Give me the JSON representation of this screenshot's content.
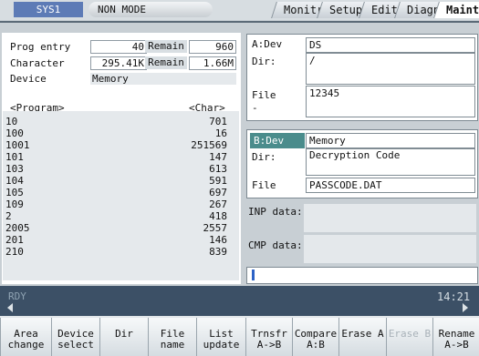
{
  "header": {
    "sys": "SYS1",
    "mode": "NON MODE",
    "tabs": [
      {
        "label": "Monitr",
        "active": false
      },
      {
        "label": "Setup",
        "active": false
      },
      {
        "label": "Edit",
        "active": false
      },
      {
        "label": "Diagn",
        "active": false
      },
      {
        "label": "Mainte",
        "active": true
      }
    ]
  },
  "stats": {
    "prog_entry_label": "Prog entry",
    "prog_entry_value": "40",
    "remain_label": "Remain",
    "prog_remain_value": "960",
    "character_label": "Character",
    "character_value": "295.41K",
    "char_remain_value": "1.66M",
    "device_label": "Device",
    "device_value": "Memory"
  },
  "program_list": {
    "col_program": "<Program>",
    "col_char": "<Char>",
    "rows": [
      {
        "name": "10",
        "chars": "701"
      },
      {
        "name": "100",
        "chars": "16"
      },
      {
        "name": "1001",
        "chars": "251569"
      },
      {
        "name": "101",
        "chars": "147"
      },
      {
        "name": "103",
        "chars": "613"
      },
      {
        "name": "104",
        "chars": "591"
      },
      {
        "name": "105",
        "chars": "697"
      },
      {
        "name": "109",
        "chars": "267"
      },
      {
        "name": "2",
        "chars": "418"
      },
      {
        "name": "2005",
        "chars": "2557"
      },
      {
        "name": "201",
        "chars": "146"
      },
      {
        "name": "210",
        "chars": "839"
      }
    ]
  },
  "panel_a": {
    "dev_label": "A:Dev",
    "dev_value": "DS",
    "dir_label": "Dir:",
    "dir_value": "/",
    "file_label": "File",
    "file_value": "12345",
    "dash": "-"
  },
  "panel_b": {
    "dev_label": "B:Dev",
    "dev_value": "Memory",
    "dir_label": "Dir:",
    "dir_value": "Decryption Code",
    "file_label": "File",
    "file_value": "PASSCODE.DAT"
  },
  "inp_label": "INP data:",
  "cmp_label": "CMP data:",
  "status": {
    "state": "RDY",
    "time": "14:21",
    "colors": {
      "bar": "#3c5066",
      "active_field": "#4a8c8c"
    }
  },
  "softkeys": [
    {
      "line1": "Area",
      "line2": "change",
      "enabled": true
    },
    {
      "line1": "Device",
      "line2": "select",
      "enabled": true
    },
    {
      "line1": "Dir",
      "line2": "",
      "enabled": true
    },
    {
      "line1": "File",
      "line2": "name",
      "enabled": true
    },
    {
      "line1": "List",
      "line2": "update",
      "enabled": true
    },
    {
      "line1": "Trnsfr",
      "line2": "A->B",
      "enabled": true
    },
    {
      "line1": "Compare",
      "line2": "A:B",
      "enabled": true
    },
    {
      "line1": "Erase A",
      "line2": "",
      "enabled": true
    },
    {
      "line1": "Erase B",
      "line2": "",
      "enabled": false
    },
    {
      "line1": "Rename",
      "line2": "A->B",
      "enabled": true
    }
  ]
}
